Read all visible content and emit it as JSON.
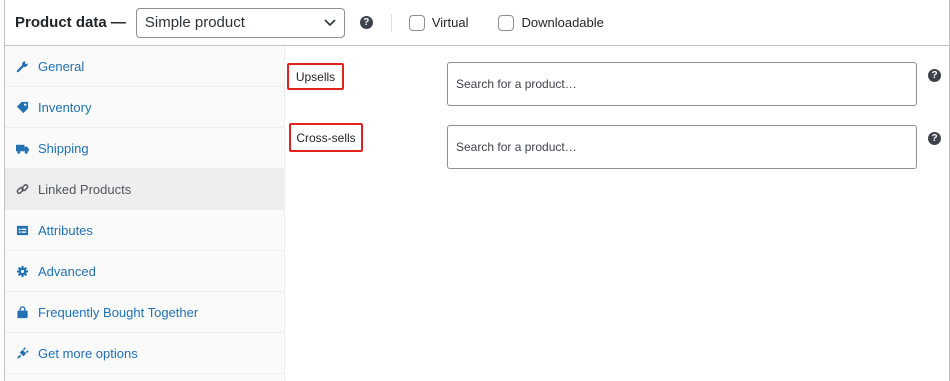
{
  "header": {
    "title": "Product data —",
    "product_type": "Simple product",
    "virtual_label": "Virtual",
    "downloadable_label": "Downloadable"
  },
  "sidebar": {
    "items": [
      {
        "label": "General",
        "icon": "wrench-icon",
        "active": false
      },
      {
        "label": "Inventory",
        "icon": "tag-icon",
        "active": false
      },
      {
        "label": "Shipping",
        "icon": "truck-icon",
        "active": false
      },
      {
        "label": "Linked Products",
        "icon": "link-icon",
        "active": true
      },
      {
        "label": "Attributes",
        "icon": "list-icon",
        "active": false
      },
      {
        "label": "Advanced",
        "icon": "gear-icon",
        "active": false
      },
      {
        "label": "Frequently Bought Together",
        "icon": "bag-icon",
        "active": false
      },
      {
        "label": "Get more options",
        "icon": "plug-icon",
        "active": false
      }
    ]
  },
  "fields": {
    "upsells": {
      "label": "Upsells",
      "placeholder": "Search for a product…"
    },
    "cross_sells": {
      "label": "Cross-sells",
      "placeholder": "Search for a product…"
    }
  },
  "colors": {
    "link": "#2271b1",
    "highlight_border": "#e0231c",
    "active_bg": "#eeeeee"
  }
}
